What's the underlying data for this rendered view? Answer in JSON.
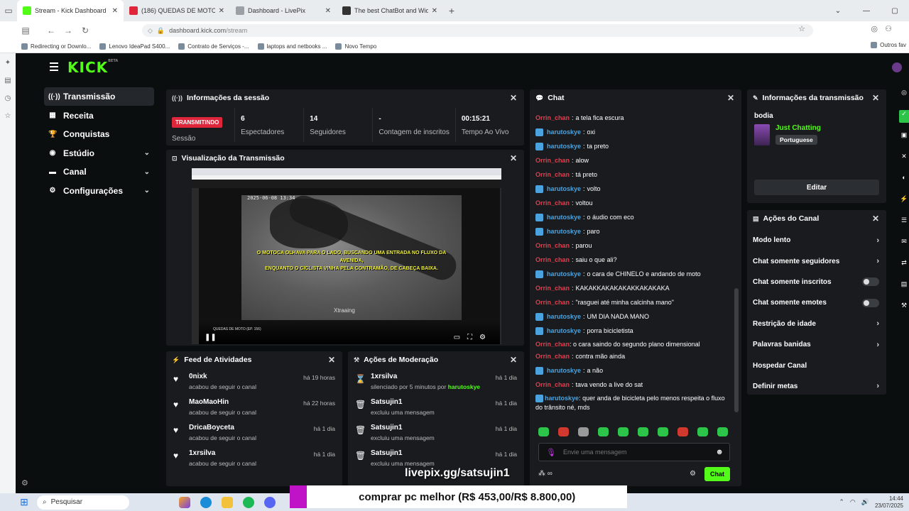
{
  "browser": {
    "tabs": [
      {
        "title": "Stream - Kick Dashboard",
        "color": "#53fc18",
        "active": true
      },
      {
        "title": "(186) QUEDAS DE MOTO (EP. 1!",
        "color": "#e0263b",
        "active": false
      },
      {
        "title": "Dashboard - LivePix",
        "color": "#9aa0a6",
        "active": false
      },
      {
        "title": "The best ChatBot and Widgets",
        "color": "#333333",
        "active": false
      }
    ],
    "url_domain": "dashboard.kick.com",
    "url_path": "/stream",
    "bookmarks": [
      "Redirecting or Downlo...",
      "Lenovo IdeaPad S400...",
      "Contrato de Serviços -...",
      "laptops and netbooks ...",
      "Novo Tempo"
    ],
    "bookmarks_right": "Outros fav"
  },
  "app": {
    "logo": "KICK",
    "logo_sup": "BETA",
    "nav": [
      {
        "label": "Transmissão",
        "icon": "((·))",
        "active": true,
        "chevron": false
      },
      {
        "label": "Receita",
        "icon": "▦",
        "active": false,
        "chevron": false
      },
      {
        "label": "Conquistas",
        "icon": "🏆",
        "active": false,
        "chevron": false
      },
      {
        "label": "Estúdio",
        "icon": "◉",
        "active": false,
        "chevron": true
      },
      {
        "label": "Canal",
        "icon": "▬",
        "active": false,
        "chevron": true
      },
      {
        "label": "Configurações",
        "icon": "⚙",
        "active": false,
        "chevron": true
      }
    ]
  },
  "session": {
    "title": "Informações da sessão",
    "badge": "TRANSMITINDO",
    "session_label": "Sessão",
    "stats": [
      {
        "value": "6",
        "label": "Espectadores"
      },
      {
        "value": "14",
        "label": "Seguidores"
      },
      {
        "value": "-",
        "label": "Contagem de inscritos"
      },
      {
        "value": "00:15:21",
        "label": "Tempo Ao Vivo"
      }
    ]
  },
  "preview": {
    "title": "Visualização da Transmissão",
    "date": "2025-06-08 13:34",
    "subtitle_1": "O MOTOCA OLHAVA PARA O LADO, BUSCANDO UMA ENTRADA NO FLUXO DA AVENIDA,",
    "subtitle_2": "ENQUANTO O CICLISTA VINHA PELA CONTRAMÃO, DE CABEÇA BAIXA.",
    "watermark": "Xtraaing",
    "video_title": "QUEDAS DE MOTO (EP. 156)"
  },
  "feed": {
    "title": "Feed de Atividades",
    "items": [
      {
        "name": "0nixk",
        "sub": "acabou de seguir o canal",
        "time": "há 19 horas"
      },
      {
        "name": "MaoMaoHin",
        "sub": "acabou de seguir o canal",
        "time": "há 22 horas"
      },
      {
        "name": "DricaBoyceta",
        "sub": "acabou de seguir o canal",
        "time": "há 1 dia"
      },
      {
        "name": "1xrsilva",
        "sub": "acabou de seguir o canal",
        "time": "há 1 dia"
      }
    ]
  },
  "mod": {
    "title": "Ações de Moderação",
    "items": [
      {
        "name": "1xrsilva",
        "sub": "silenciado por 5 minutos por",
        "by": "harutoskye",
        "time": "há 1 dia",
        "icon": "⌛"
      },
      {
        "name": "Satsujin1",
        "sub": "excluiu uma mensagem",
        "by": "",
        "time": "há 1 dia",
        "icon": "🗑"
      },
      {
        "name": "Satsujin1",
        "sub": "excluiu uma mensagem",
        "by": "",
        "time": "há 1 dia",
        "icon": "🗑"
      },
      {
        "name": "Satsujin1",
        "sub": "excluiu uma mensagem",
        "by": "",
        "time": "há 1 dia",
        "icon": "🗑"
      }
    ]
  },
  "chat": {
    "title": "Chat",
    "messages": [
      {
        "user": "Orrin_chan",
        "type": "u1",
        "text": "a tela fica escura"
      },
      {
        "user": "harutoskye",
        "type": "u2",
        "text": "oxi"
      },
      {
        "user": "harutoskye",
        "type": "u2",
        "text": "ta preto"
      },
      {
        "user": "Orrin_chan",
        "type": "u1",
        "text": "alow"
      },
      {
        "user": "Orrin_chan",
        "type": "u1",
        "text": "tá preto"
      },
      {
        "user": "harutoskye",
        "type": "u2",
        "text": "volto"
      },
      {
        "user": "Orrin_chan",
        "type": "u1",
        "text": "voltou"
      },
      {
        "user": "harutoskye",
        "type": "u2",
        "text": "o áudio com eco"
      },
      {
        "user": "harutoskye",
        "type": "u2",
        "text": "paro"
      },
      {
        "user": "Orrin_chan",
        "type": "u1",
        "text": "parou"
      },
      {
        "user": "Orrin_chan",
        "type": "u1",
        "text": "saiu o que ali?"
      },
      {
        "user": "harutoskye",
        "type": "u2",
        "text": "o cara de CHINELO e andando de moto"
      },
      {
        "user": "Orrin_chan",
        "type": "u1",
        "text": "KAKAKKAKAKAKAKKAKAKAKA"
      },
      {
        "user": "Orrin_chan",
        "type": "u1",
        "text": "\"rasguei até minha calcinha mano\""
      },
      {
        "user": "harutoskye",
        "type": "u2",
        "text": "UM DIA NADA MANO"
      },
      {
        "user": "harutoskye",
        "type": "u2",
        "text": "porra bicicletista"
      },
      {
        "user": "Orrin_chan",
        "type": "u1",
        "text": "o cara saindo do segundo plano dimensional"
      },
      {
        "user": "Orrin_chan",
        "type": "u1",
        "text": "contra mão ainda"
      },
      {
        "user": "harutoskye",
        "type": "u2",
        "text": "a não"
      },
      {
        "user": "Orrin_chan",
        "type": "u1",
        "text": "tava vendo a live do sat"
      },
      {
        "user": "harutoskye",
        "type": "u2",
        "text": "quer anda de bicicleta pelo menos respeita o fluxo do trânsito né, mds"
      }
    ],
    "input_placeholder": "Envie uma mensagem",
    "send_label": "Chat"
  },
  "stream_info": {
    "title": "Informações da transmissão",
    "stream_title": "bodia",
    "category": "Just Chatting",
    "language": "Portuguese",
    "edit_label": "Editar"
  },
  "channel_actions": {
    "title": "Ações do Canal",
    "items": [
      {
        "label": "Modo lento",
        "control": "chevron"
      },
      {
        "label": "Chat somente seguidores",
        "control": "chevron"
      },
      {
        "label": "Chat somente inscritos",
        "control": "toggle"
      },
      {
        "label": "Chat somente emotes",
        "control": "toggle"
      },
      {
        "label": "Restrição de idade",
        "control": "chevron"
      },
      {
        "label": "Palavras banidas",
        "control": "chevron"
      },
      {
        "label": "Hospedar Canal",
        "control": "none"
      },
      {
        "label": "Definir metas",
        "control": "chevron"
      }
    ]
  },
  "overlay": {
    "link": "livepix.gg/satsujin1",
    "goal": "comprar pc melhor (R$ 453,00/R$ 8.800,00)",
    "goal_progress": 0.0515
  },
  "taskbar": {
    "search": "Pesquisar",
    "time": "14:44",
    "date": "23/07/2025"
  }
}
